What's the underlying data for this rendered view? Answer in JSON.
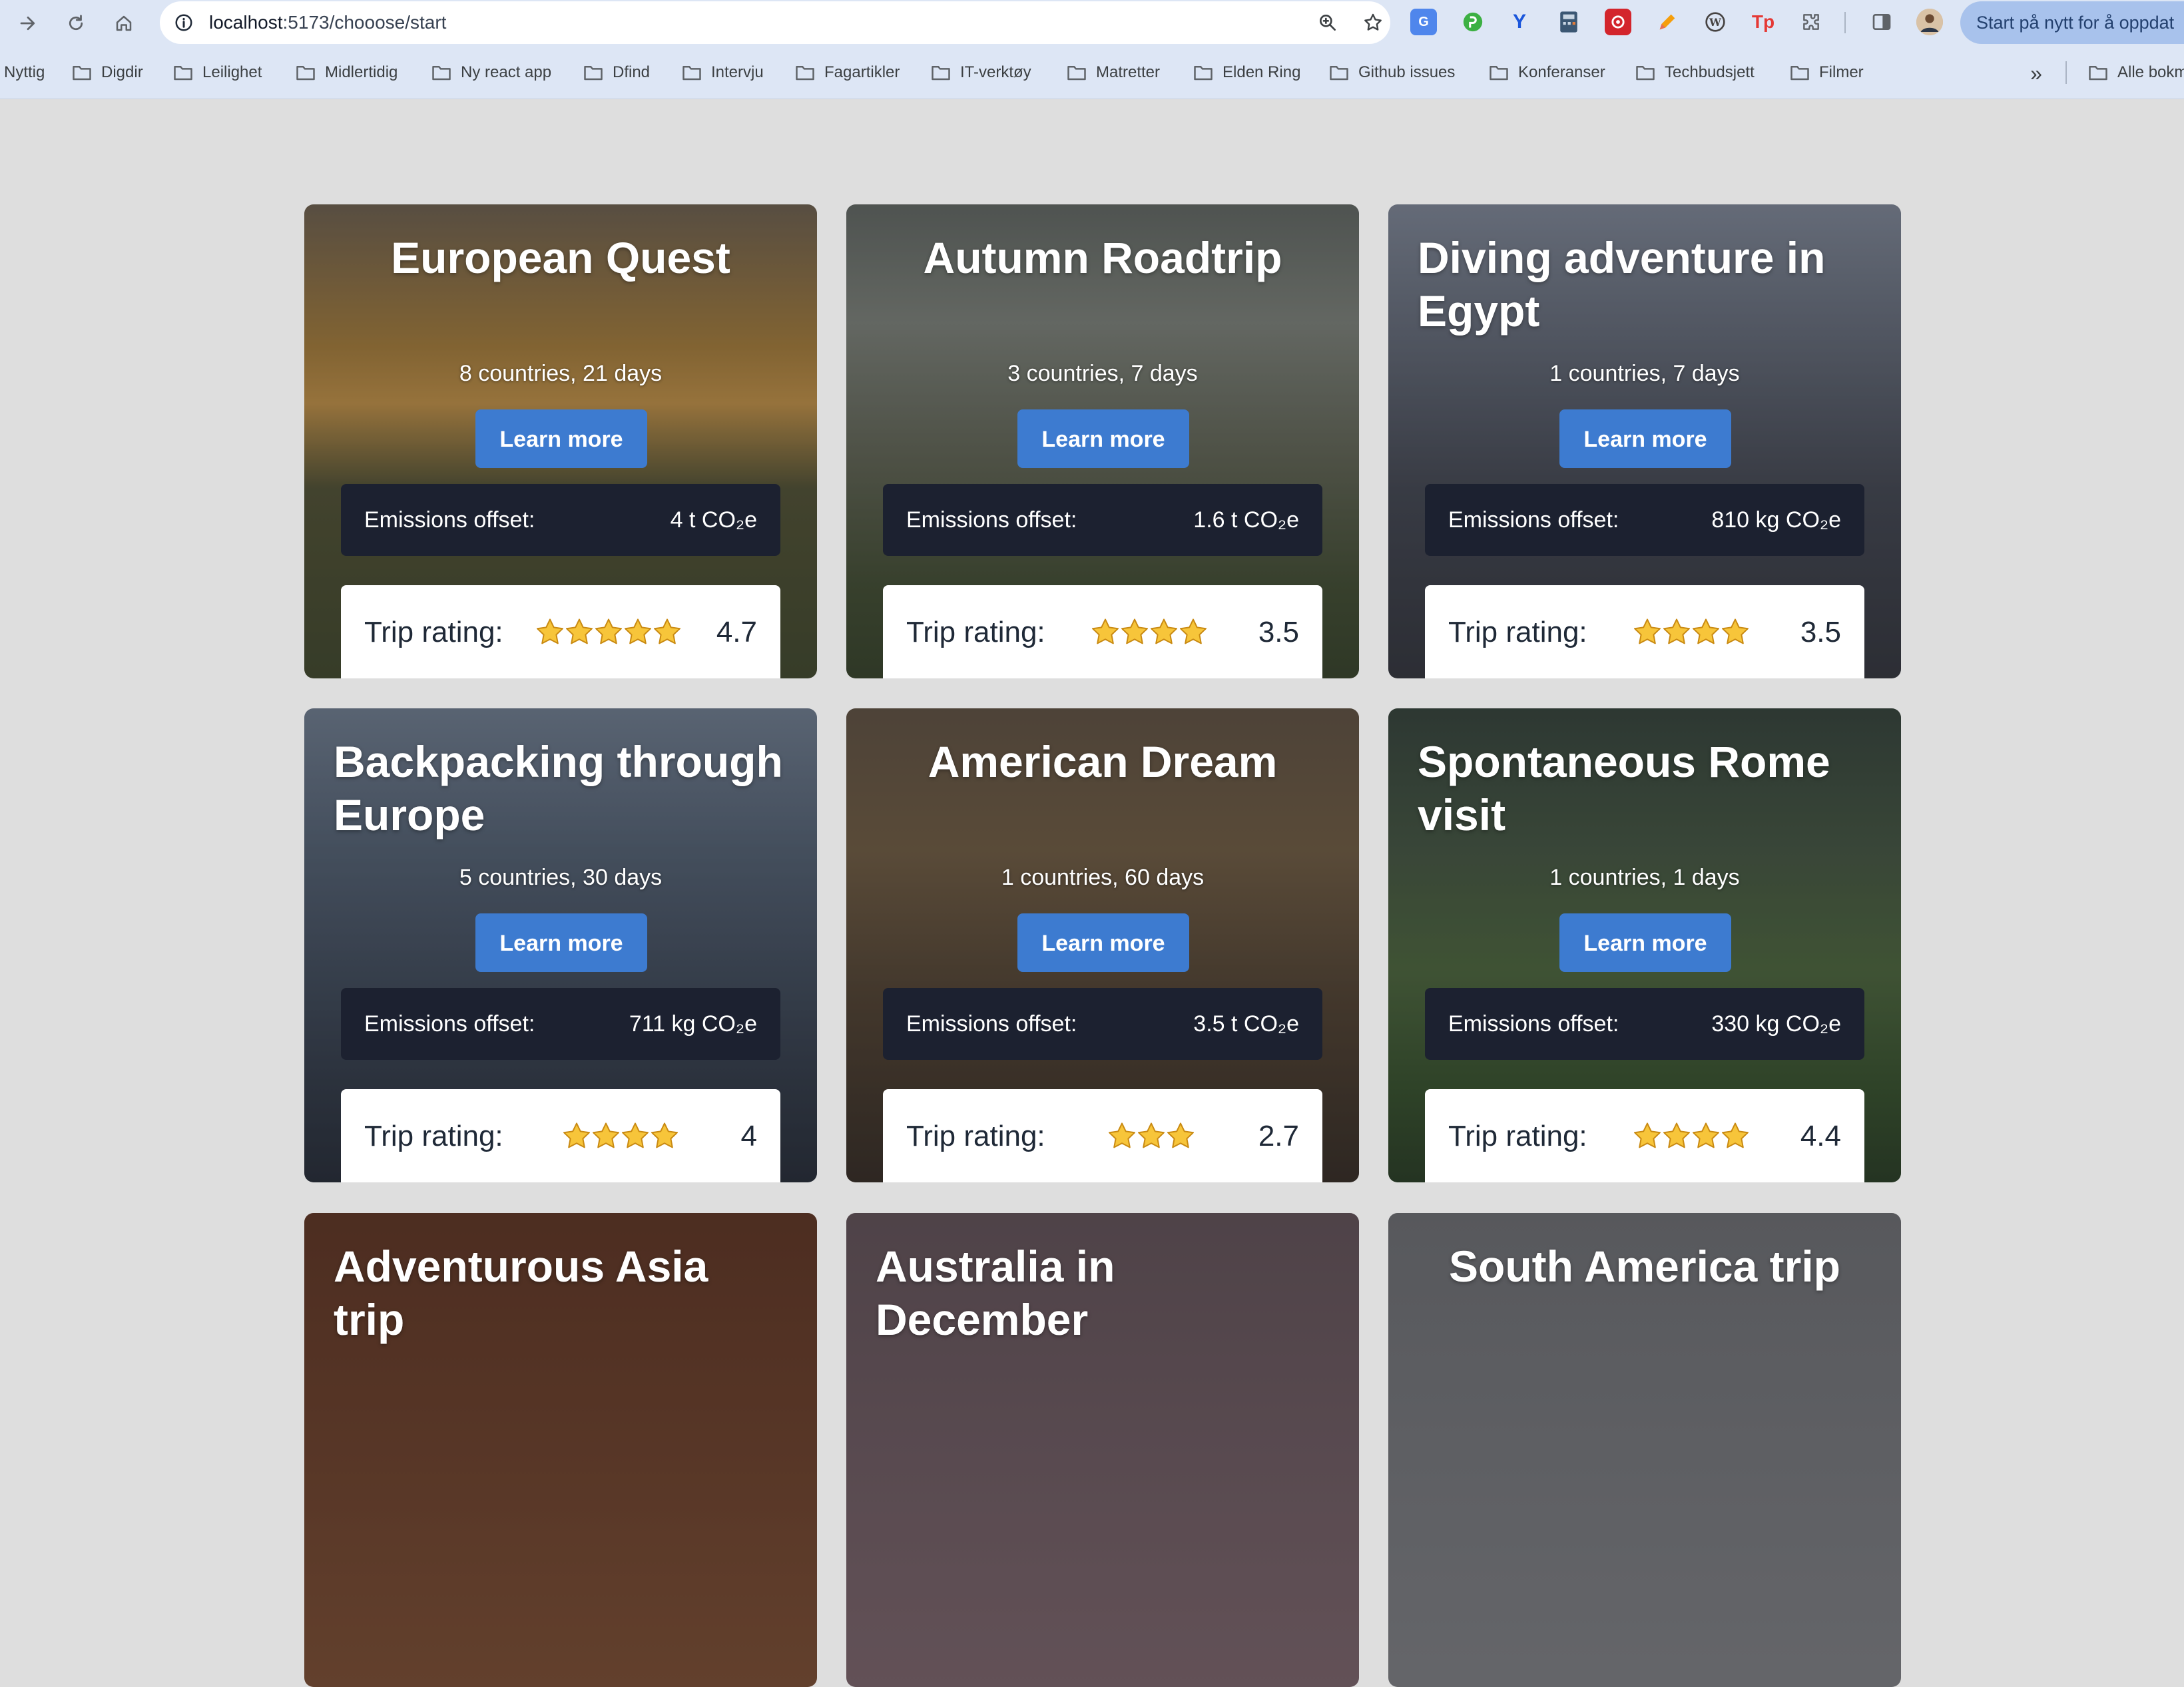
{
  "browser": {
    "url_host": "localhost",
    "url_path": ":5173/chooose/start",
    "restart_label": "Start på nytt for å oppdat",
    "bookmarks": [
      "Nyttig",
      "Digdir",
      "Leilighet",
      "Midlertidig",
      "Ny react app",
      "Dfind",
      "Intervju",
      "Fagartikler",
      "IT-verktøy",
      "Matretter",
      "Elden Ring",
      "Github issues",
      "Konferanser",
      "Techbudsjett",
      "Filmer"
    ],
    "all_bookmarks": "Alle bokm",
    "more_label": "»"
  },
  "labels": {
    "learn_more": "Learn more",
    "emissions": "Emissions offset:",
    "rating": "Trip rating:"
  },
  "trips": [
    {
      "title": "European Quest",
      "subtitle": "8 countries, 21 days",
      "emissions": "4 t CO₂e",
      "rating": "4.7",
      "stars": 5
    },
    {
      "title": "Autumn Roadtrip",
      "subtitle": "3 countries, 7 days",
      "emissions": "1.6 t CO₂e",
      "rating": "3.5",
      "stars": 4
    },
    {
      "title": "Diving adventure in Egypt",
      "subtitle": "1 countries, 7 days",
      "emissions": "810 kg CO₂e",
      "rating": "3.5",
      "stars": 4
    },
    {
      "title": "Backpacking through Europe",
      "subtitle": "5 countries, 30 days",
      "emissions": "711 kg CO₂e",
      "rating": "4",
      "stars": 4
    },
    {
      "title": "American Dream",
      "subtitle": "1 countries, 60 days",
      "emissions": "3.5 t CO₂e",
      "rating": "2.7",
      "stars": 3
    },
    {
      "title": "Spontaneous Rome visit",
      "subtitle": "1 countries, 1 days",
      "emissions": "330 kg CO₂e",
      "rating": "4.4",
      "stars": 4
    },
    {
      "title": "Adventurous Asia trip"
    },
    {
      "title": "Australia in December"
    },
    {
      "title": "South America trip"
    }
  ]
}
